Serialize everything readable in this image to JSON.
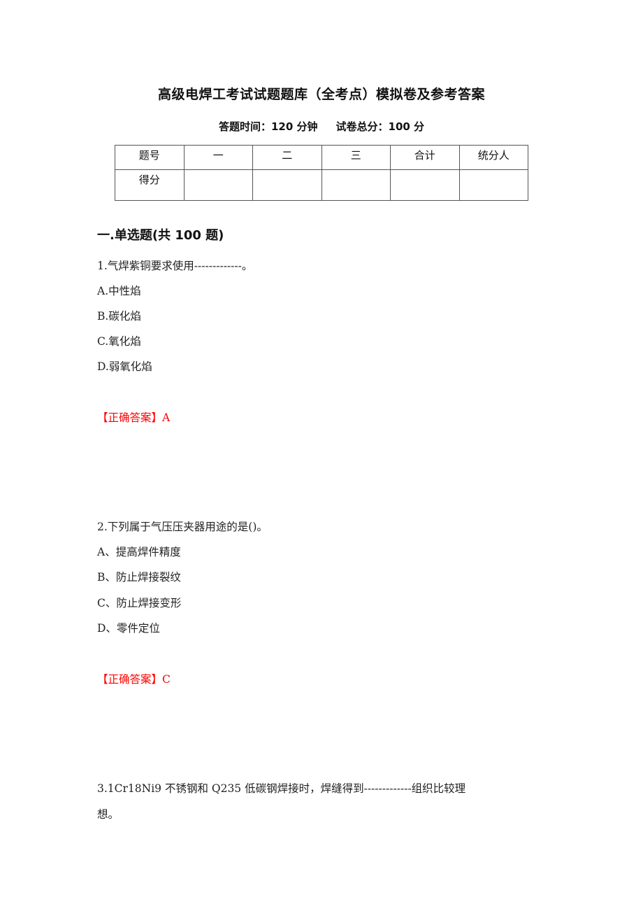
{
  "document": {
    "title": "高级电焊工考试试题题库（全考点）模拟卷及参考答案",
    "exam_time": "答题时间：120 分钟",
    "total_score": "试卷总分：100 分"
  },
  "score_table": {
    "header_row": [
      "题号",
      "一",
      "二",
      "三",
      "合计",
      "统分人"
    ],
    "score_row": [
      "得分",
      "",
      "",
      "",
      "",
      ""
    ]
  },
  "section": {
    "heading": "一.单选题(共 100 题)"
  },
  "questions": [
    {
      "stem": "1.气焊紫铜要求使用-------------。",
      "options": [
        "A.中性焰",
        "B.碳化焰",
        "C.氧化焰",
        "D.弱氧化焰"
      ],
      "answer": "【正确答案】A"
    },
    {
      "stem": "2.下列属于气压压夹器用途的是()。",
      "options": [
        "A、提高焊件精度",
        "B、防止焊接裂纹",
        "C、防止焊接变形",
        "D、零件定位"
      ],
      "answer": "【正确答案】C"
    },
    {
      "stem_line1": "3.1Cr18Ni9 不锈钢和 Q235 低碳钢焊接时，焊缝得到-------------组织比较理",
      "stem_line2": "想。"
    }
  ],
  "colors": {
    "answer": "#ff0000",
    "text": "#222222"
  }
}
